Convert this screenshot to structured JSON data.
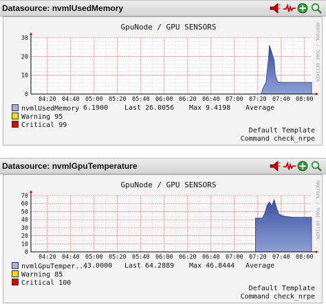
{
  "panels": [
    {
      "title": "Datasource: nvmlUsedMemory",
      "graph_title": "GpuNode / GPU SENSORS",
      "watermark": "RRDTOOL / TOBI OETIKER",
      "chart_data": {
        "type": "area",
        "title": "GpuNode / GPU SENSORS",
        "x_ticks": [
          "04:20",
          "04:40",
          "05:00",
          "05:20",
          "05:40",
          "06:00",
          "06:20",
          "06:40",
          "07:00",
          "07:20",
          "07:40",
          "08:00"
        ],
        "ylim": [
          0,
          30
        ],
        "y_ticks": [
          0,
          10,
          20,
          30
        ],
        "grid": true,
        "series": [
          {
            "name": "nvmlUsedMemory",
            "color": "#3a4fa0",
            "x": [
              "07:18",
              "07:23",
              "07:24",
              "07:27",
              "07:29",
              "07:30",
              "07:32",
              "07:34",
              "07:35",
              "07:37",
              "07:39",
              "07:41",
              "08:06"
            ],
            "values": [
              0,
              0,
              2.5,
              6.2,
              18.0,
              26.0,
              22.0,
              18.0,
              10.0,
              6.5,
              6.2,
              6.19,
              6.19
            ]
          }
        ],
        "thresholds": [
          {
            "name": "Warning",
            "value": 95,
            "color": "#f0e000"
          },
          {
            "name": "Critical",
            "value": 99,
            "color": "#e00000"
          }
        ]
      },
      "legend": {
        "series_label": "nvmlUsedMemory",
        "current": "6.1900",
        "last_label": "Last",
        "last_value": "26.0056",
        "max_label": "Max",
        "max_value": "9.4198",
        "avg_label": "Average",
        "warning_label": "Warning",
        "warning_value": "95",
        "critical_label": "Critical",
        "critical_value": "99"
      },
      "template_line": "Default Template",
      "command_line": "Command check_nrpe"
    },
    {
      "title": "Datasource: nvmlGpuTemperature",
      "graph_title": "GpuNode / GPU SENSORS",
      "watermark": "RRDTOOL / TOBI OETIKER",
      "chart_data": {
        "type": "area",
        "title": "GpuNode / GPU SENSORS",
        "x_ticks": [
          "04:20",
          "04:40",
          "05:00",
          "05:20",
          "05:40",
          "06:00",
          "06:20",
          "06:40",
          "07:00",
          "07:20",
          "07:40",
          "08:00"
        ],
        "ylim": [
          0,
          70
        ],
        "y_ticks": [
          0,
          10,
          20,
          30,
          40,
          50,
          60,
          70
        ],
        "grid": true,
        "series": [
          {
            "name": "nvmlGpuTemperature",
            "color": "#3a4fa0",
            "x": [
              "07:18",
              "07:24",
              "07:26",
              "07:28",
              "07:30",
              "07:32",
              "07:34",
              "07:36",
              "07:38",
              "07:41",
              "07:44",
              "07:50",
              "08:06"
            ],
            "values": [
              42,
              42,
              48,
              58,
              62,
              57,
              65,
              55,
              47,
              45,
              44,
              43,
              43
            ]
          }
        ],
        "thresholds": [
          {
            "name": "Warning",
            "value": 85,
            "color": "#f0e000"
          },
          {
            "name": "Critical",
            "value": 100,
            "color": "#e00000"
          }
        ]
      },
      "legend": {
        "series_label": "nvmlGpuTemper...",
        "current": "43.0000",
        "last_label": "Last",
        "last_value": "64.2889",
        "max_label": "Max",
        "max_value": "46.8444",
        "avg_label": "Average",
        "warning_label": "Warning",
        "warning_value": "85",
        "critical_label": "Critical",
        "critical_value": "100"
      },
      "template_line": "Default Template",
      "command_line": "Command check_nrpe"
    }
  ],
  "colors": {
    "area": "#3a4fa0",
    "area_light": "#8fa0d6",
    "grid_minor": "#f2b8b8",
    "grid_major": "#e08080",
    "warning": "#f0e000",
    "critical": "#e00000"
  },
  "header_icons": [
    "alarm-icon",
    "graph-zigzag-icon",
    "add-icon",
    "zoom-icon"
  ]
}
